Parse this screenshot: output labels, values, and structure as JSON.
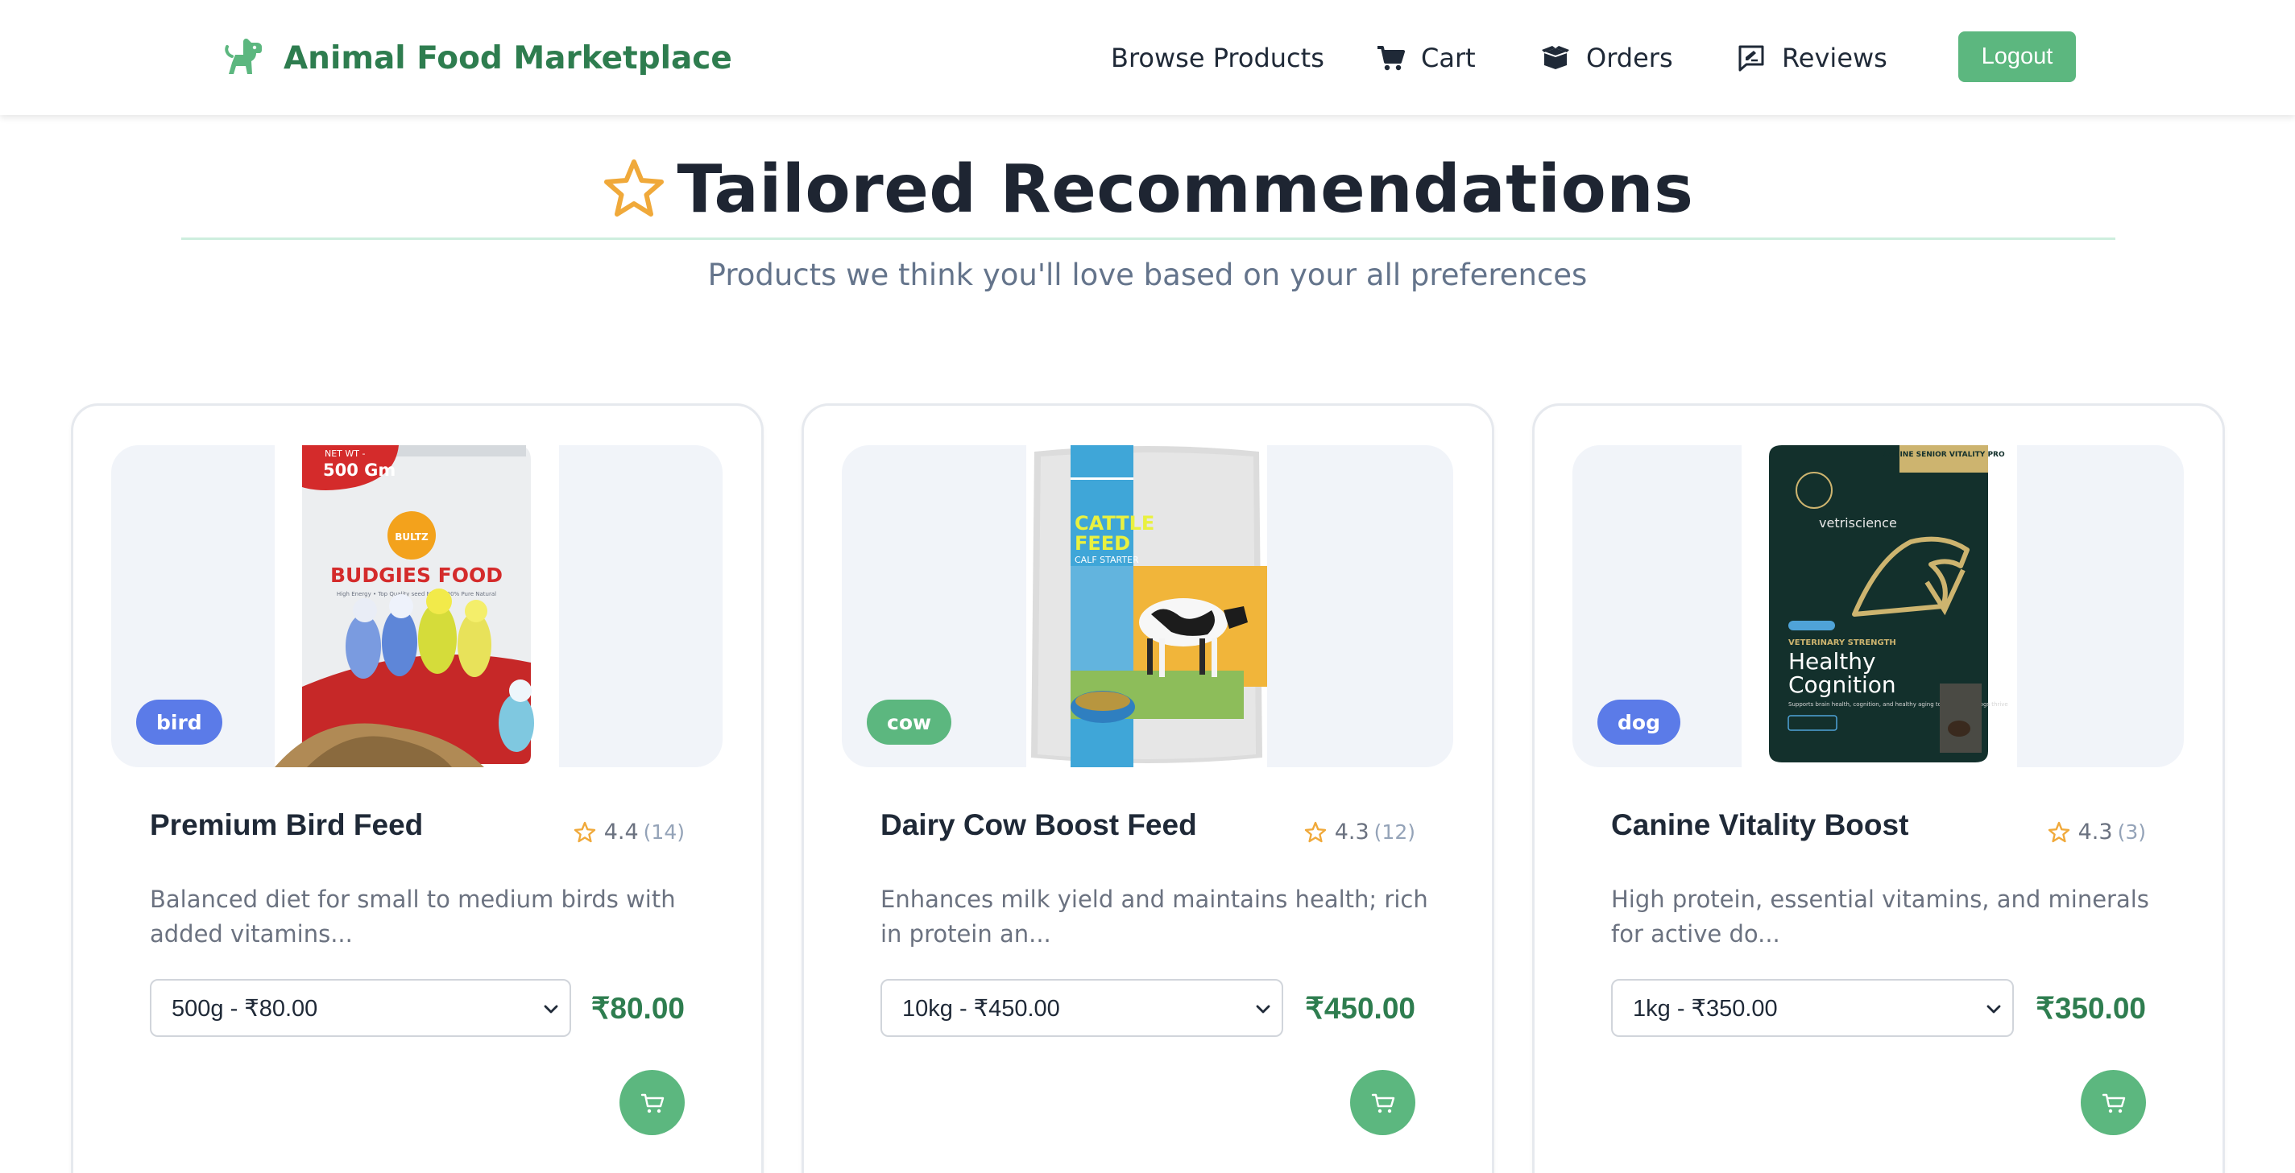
{
  "brand": {
    "name": "Animal Food Marketplace",
    "icon": "dog-icon",
    "color": "#2e7d4f"
  },
  "nav": {
    "browse": "Browse Products",
    "cart": "Cart",
    "orders": "Orders",
    "reviews": "Reviews",
    "logout": "Logout"
  },
  "page": {
    "title": "Tailored Recommendations",
    "subtitle": "Products we think you'll love based on your all preferences"
  },
  "colors": {
    "accent": "#5cb77f",
    "price": "#2e7d4f",
    "badge_bird": "#5b7be8",
    "badge_cow": "#5cb77f",
    "badge_dog": "#5b7be8",
    "star": "#f0a93a"
  },
  "products": [
    {
      "tag": "bird",
      "name": "Premium Bird Feed",
      "rating": "4.4",
      "reviews": "(14)",
      "description": "Balanced diet for small to medium birds with added vitamins...",
      "selected_variant": "500g - ₹80.00",
      "price": "₹80.00",
      "image": {
        "ribbon_top": "NET WT -",
        "ribbon_main": "500 Gm",
        "logo": "BULTZ",
        "title": "BUDGIES FOOD",
        "tagline": "High Energy • Top Quality seed Mix • 100% Pure Natural"
      }
    },
    {
      "tag": "cow",
      "name": "Dairy Cow Boost Feed",
      "rating": "4.3",
      "reviews": "(12)",
      "description": "Enhances milk yield and maintains health; rich in protein an...",
      "selected_variant": "10kg - ₹450.00",
      "price": "₹450.00",
      "image": {
        "line1": "CATTLE",
        "line2": "FEED",
        "line3": "CALF STARTER"
      }
    },
    {
      "tag": "dog",
      "name": "Canine Vitality Boost",
      "rating": "4.3",
      "reviews": "(3)",
      "description": "High protein, essential vitamins, and minerals for active do...",
      "selected_variant": "1kg - ₹350.00",
      "price": "₹350.00",
      "image": {
        "corner": "CANINE SENIOR VITALITY PRO",
        "brand": "vetriscience",
        "kicker": "VETERINARY STRENGTH",
        "title1": "Healthy",
        "title2": "Cognition",
        "support": "Supports brain health, cognition, and healthy aging to help senior dogs thrive"
      }
    }
  ]
}
